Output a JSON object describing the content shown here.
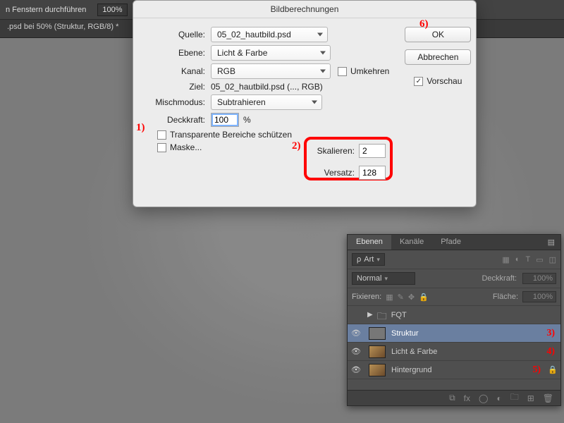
{
  "toolbar": {
    "windows_text": "n Fenstern durchführen",
    "zoom": "100%"
  },
  "document_tab": ".psd bei 50% (Struktur, RGB/8) *",
  "dialog": {
    "title": "Bildberechnungen",
    "source_label": "Quelle:",
    "source_value": "05_02_hautbild.psd",
    "layer_label": "Ebene:",
    "layer_value": "Licht & Farbe",
    "channel_label": "Kanal:",
    "channel_value": "RGB",
    "invert_label": "Umkehren",
    "target_label": "Ziel:",
    "target_value": "05_02_hautbild.psd (..., RGB)",
    "blend_label": "Mischmodus:",
    "blend_value": "Subtrahieren",
    "opacity_label": "Deckkraft:",
    "opacity_value": "100",
    "opacity_unit": "%",
    "preserve_label": "Transparente Bereiche schützen",
    "mask_label": "Maske...",
    "scale_label": "Skalieren:",
    "scale_value": "2",
    "offset_label": "Versatz:",
    "offset_value": "128",
    "ok": "OK",
    "cancel": "Abbrechen",
    "preview": "Vorschau"
  },
  "annotations": {
    "a1": "1)",
    "a2": "2)",
    "a3": "3)",
    "a4": "4)",
    "a5": "5)",
    "a6": "6)"
  },
  "layers_panel": {
    "tabs": {
      "layers": "Ebenen",
      "channels": "Kanäle",
      "paths": "Pfade"
    },
    "kind_filter": "Art",
    "blend_mode": "Normal",
    "opacity_label": "Deckkraft:",
    "opacity_value": "100%",
    "lock_label": "Fixieren:",
    "fill_label": "Fläche:",
    "fill_value": "100%",
    "layers": [
      {
        "name": "FQT",
        "type": "group"
      },
      {
        "name": "Struktur",
        "type": "layer",
        "selected": true
      },
      {
        "name": "Licht & Farbe",
        "type": "layer"
      },
      {
        "name": "Hintergrund",
        "type": "layer",
        "locked": true
      }
    ]
  }
}
